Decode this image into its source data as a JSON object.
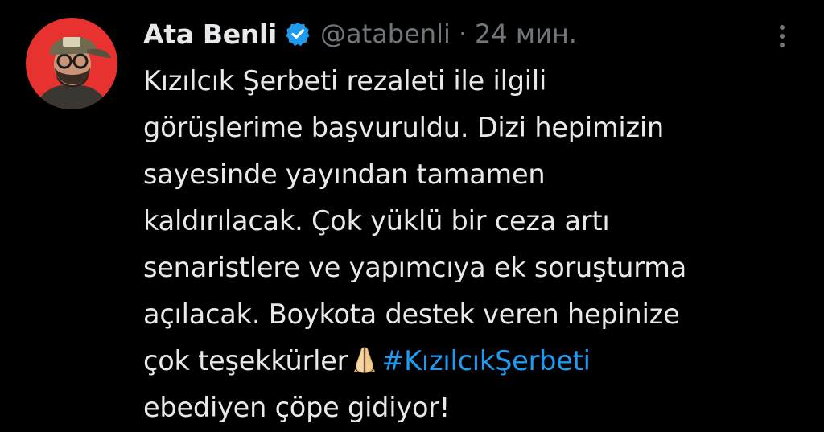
{
  "author": {
    "display_name": "Ata Benli",
    "handle": "@atabenli",
    "separator": "·",
    "time": "24 мин."
  },
  "tweet": {
    "lines": [
      "Kızılcık Şerbeti rezaleti ile ilgili",
      "görüşlerime başvuruldu. Dizi hepimizin",
      "sayesinde yayından tamamen",
      "kaldırılacak. Çok yüklü bir ceza artı",
      "senaristlere ve yapımcıya ek soruşturma",
      "açılacak. Boykota destek veren hepinize"
    ],
    "line7_text": "çok teşekkürler",
    "hashtag": "#KızılcıkŞerbeti",
    "line8_text": "ebediyen çöpe gidiyor!"
  },
  "icons": {
    "verified": "verified-badge-icon",
    "more": "more-vertical-icon",
    "emoji": "folded-hands-emoji"
  },
  "colors": {
    "background": "#000000",
    "text": "#e7e9ea",
    "secondary": "#71767b",
    "accent": "#1d9bf0",
    "avatar_bg": "#e8322f"
  }
}
